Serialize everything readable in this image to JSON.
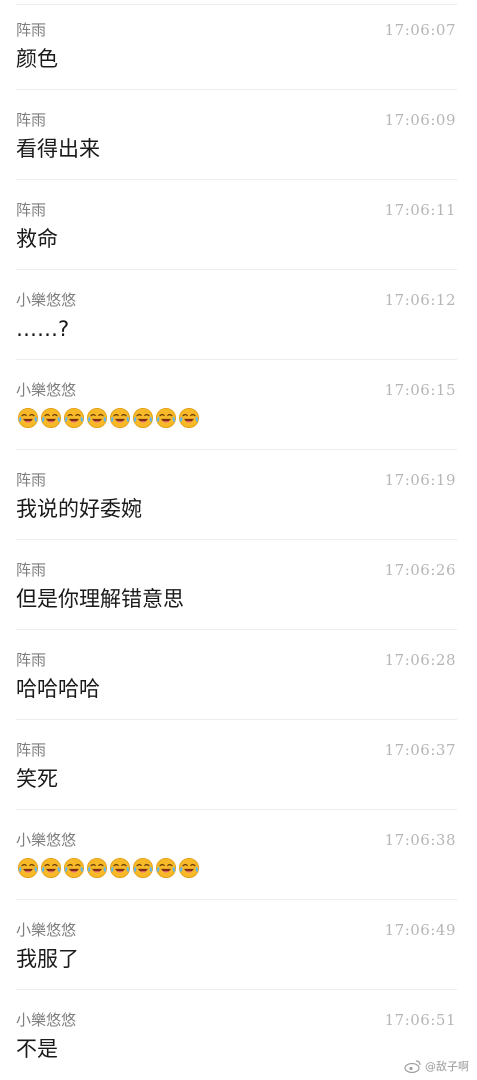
{
  "messages": [
    {
      "sender": "阵雨",
      "time": "17:06:07",
      "text": "颜色"
    },
    {
      "sender": "阵雨",
      "time": "17:06:09",
      "text": "看得出来"
    },
    {
      "sender": "阵雨",
      "time": "17:06:11",
      "text": "救命"
    },
    {
      "sender": "小樂悠悠",
      "time": "17:06:12",
      "text": "……?"
    },
    {
      "sender": "小樂悠悠",
      "time": "17:06:15",
      "emoji": "laughing-crying-face",
      "emoji_count": 8
    },
    {
      "sender": "阵雨",
      "time": "17:06:19",
      "text": "我说的好委婉"
    },
    {
      "sender": "阵雨",
      "time": "17:06:26",
      "text": "但是你理解错意思"
    },
    {
      "sender": "阵雨",
      "time": "17:06:28",
      "text": "哈哈哈哈"
    },
    {
      "sender": "阵雨",
      "time": "17:06:37",
      "text": "笑死"
    },
    {
      "sender": "小樂悠悠",
      "time": "17:06:38",
      "emoji": "laughing-crying-face",
      "emoji_count": 8
    },
    {
      "sender": "小樂悠悠",
      "time": "17:06:49",
      "text": "我服了"
    },
    {
      "sender": "小樂悠悠",
      "time": "17:06:51",
      "text": "不是"
    }
  ],
  "watermark": {
    "icon": "weibo-icon",
    "text": "@敌子啊"
  },
  "colors": {
    "sender": "#7e7e7e",
    "time": "#b6b6b6",
    "text": "#1a1a1a",
    "divider": "#ededed",
    "emoji_face": "#f7b928"
  }
}
